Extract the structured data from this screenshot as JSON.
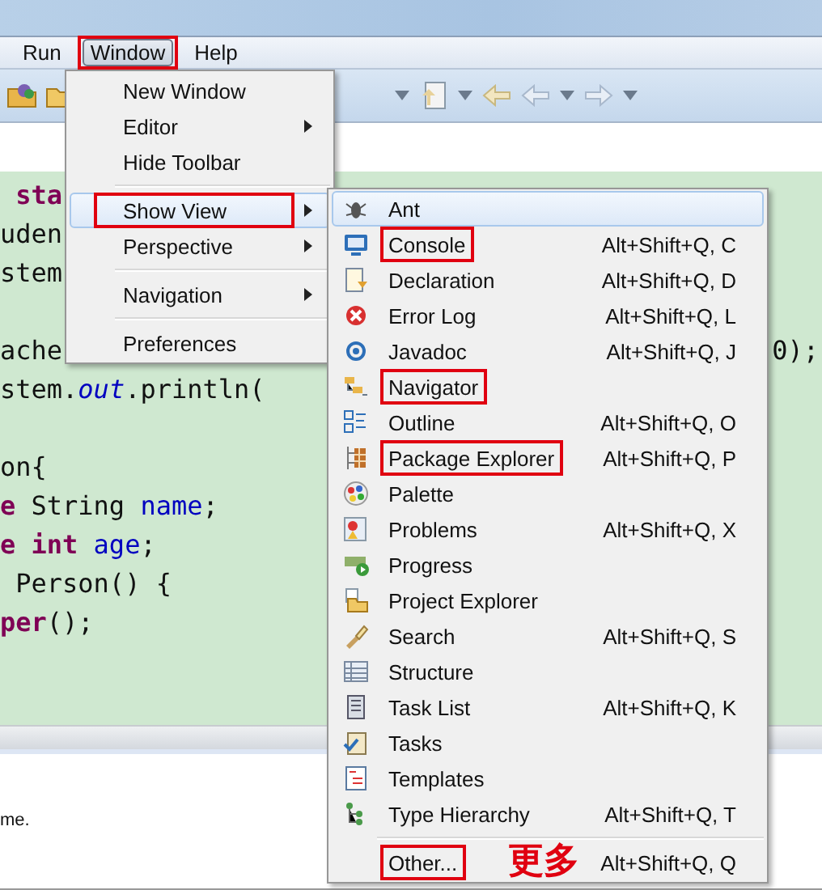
{
  "menubar": [
    {
      "label": "Run",
      "open": false,
      "annotated": false
    },
    {
      "label": "Window",
      "open": true,
      "annotated": true
    },
    {
      "label": "Help",
      "open": false,
      "annotated": false
    }
  ],
  "code_lines": [
    {
      "kind": "code",
      "segments": [
        {
          "text": " sta",
          "kind": "keyword"
        }
      ]
    },
    {
      "kind": "code",
      "segments": [
        {
          "text": "uden",
          "kind": "plain"
        }
      ]
    },
    {
      "kind": "code",
      "segments": [
        {
          "text": "stem",
          "kind": "plain"
        }
      ]
    },
    {
      "kind": "blank"
    },
    {
      "kind": "code",
      "segments": [
        {
          "text": "ache",
          "kind": "plain"
        }
      ],
      "right": "0);"
    },
    {
      "kind": "code",
      "segments": [
        {
          "text": "stem.",
          "kind": "plain"
        },
        {
          "text": "out",
          "kind": "static"
        },
        {
          "text": ".println(",
          "kind": "plain"
        }
      ]
    },
    {
      "kind": "blank"
    },
    {
      "kind": "code",
      "segments": [
        {
          "text": "on{",
          "kind": "plain"
        }
      ]
    },
    {
      "kind": "code",
      "segments": [
        {
          "text": "e ",
          "kind": "keyword"
        },
        {
          "text": "String ",
          "kind": "plain"
        },
        {
          "text": "name",
          "kind": "field"
        },
        {
          "text": ";",
          "kind": "plain"
        }
      ]
    },
    {
      "kind": "code",
      "segments": [
        {
          "text": "e int ",
          "kind": "keyword"
        },
        {
          "text": "age",
          "kind": "field"
        },
        {
          "text": ";",
          "kind": "plain"
        }
      ]
    },
    {
      "kind": "code",
      "segments": [
        {
          "text": " Person() {",
          "kind": "plain"
        }
      ]
    },
    {
      "kind": "code",
      "segments": [
        {
          "text": "per",
          "kind": "keyword"
        },
        {
          "text": "();",
          "kind": "plain"
        }
      ]
    }
  ],
  "bottom_panel": {
    "text": "me."
  },
  "window_menu": [
    {
      "kind": "item",
      "label": "New Window",
      "submenu": false,
      "selected": false,
      "annotated": false
    },
    {
      "kind": "item",
      "label": "Editor",
      "submenu": true,
      "selected": false,
      "annotated": false
    },
    {
      "kind": "item",
      "label": "Hide Toolbar",
      "submenu": false,
      "selected": false,
      "annotated": false
    },
    {
      "kind": "separator"
    },
    {
      "kind": "item",
      "label": "Show View",
      "submenu": true,
      "selected": true,
      "annotated": true
    },
    {
      "kind": "item",
      "label": "Perspective",
      "submenu": true,
      "selected": false,
      "annotated": false
    },
    {
      "kind": "separator"
    },
    {
      "kind": "item",
      "label": "Navigation",
      "submenu": true,
      "selected": false,
      "annotated": false
    },
    {
      "kind": "separator"
    },
    {
      "kind": "item",
      "label": "Preferences",
      "submenu": false,
      "selected": false,
      "annotated": false
    }
  ],
  "show_view_menu": [
    {
      "kind": "item",
      "label": "Ant",
      "selected": true,
      "annotated": false
    },
    {
      "kind": "item",
      "label": "Console",
      "shortcut": "Alt+Shift+Q, C",
      "selected": false,
      "annotated": true
    },
    {
      "kind": "item",
      "label": "Declaration",
      "shortcut": "Alt+Shift+Q, D",
      "selected": false,
      "annotated": false
    },
    {
      "kind": "item",
      "label": "Error Log",
      "shortcut": "Alt+Shift+Q, L",
      "selected": false,
      "annotated": false
    },
    {
      "kind": "item",
      "label": "Javadoc",
      "shortcut": "Alt+Shift+Q, J",
      "selected": false,
      "annotated": false
    },
    {
      "kind": "item",
      "label": "Navigator",
      "selected": false,
      "annotated": true
    },
    {
      "kind": "item",
      "label": "Outline",
      "shortcut": "Alt+Shift+Q, O",
      "selected": false,
      "annotated": false
    },
    {
      "kind": "item",
      "label": "Package Explorer",
      "shortcut": "Alt+Shift+Q, P",
      "selected": false,
      "annotated": true
    },
    {
      "kind": "item",
      "label": "Palette",
      "selected": false,
      "annotated": false
    },
    {
      "kind": "item",
      "label": "Problems",
      "shortcut": "Alt+Shift+Q, X",
      "selected": false,
      "annotated": false
    },
    {
      "kind": "item",
      "label": "Progress",
      "selected": false,
      "annotated": false
    },
    {
      "kind": "item",
      "label": "Project Explorer",
      "selected": false,
      "annotated": false
    },
    {
      "kind": "item",
      "label": "Search",
      "shortcut": "Alt+Shift+Q, S",
      "selected": false,
      "annotated": false
    },
    {
      "kind": "item",
      "label": "Structure",
      "selected": false,
      "annotated": false
    },
    {
      "kind": "item",
      "label": "Task List",
      "shortcut": "Alt+Shift+Q, K",
      "selected": false,
      "annotated": false
    },
    {
      "kind": "item",
      "label": "Tasks",
      "selected": false,
      "annotated": false
    },
    {
      "kind": "item",
      "label": "Templates",
      "selected": false,
      "annotated": false
    },
    {
      "kind": "item",
      "label": "Type Hierarchy",
      "shortcut": "Alt+Shift+Q, T",
      "selected": false,
      "annotated": false
    },
    {
      "kind": "separator"
    },
    {
      "kind": "item",
      "label": "Other...",
      "shortcut": "Alt+Shift+Q, Q",
      "selected": false,
      "annotated": true
    }
  ],
  "annotation": {
    "text": "更多"
  }
}
